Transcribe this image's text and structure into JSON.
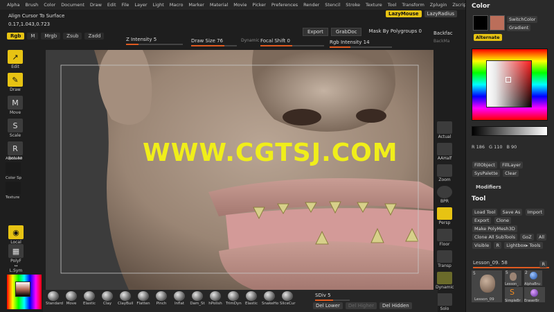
{
  "menu": [
    "Alpha",
    "Brush",
    "Color",
    "Document",
    "Draw",
    "Edit",
    "File",
    "Layer",
    "Light",
    "Macro",
    "Marker",
    "Material",
    "Movie",
    "Picker",
    "Preferences",
    "Render",
    "Stencil",
    "Stroke",
    "Texture",
    "Tool",
    "Transform",
    "Zplugin",
    "Zscript"
  ],
  "lazy": {
    "mouse": "LazyMouse",
    "radius": "LazyRadius"
  },
  "info": {
    "line1": "Align Cursor To Surface",
    "line2": "0.17,1.043,0.723"
  },
  "modes": {
    "rgb": "Rgb",
    "m": "M",
    "mrgb": "Mrgb",
    "zsub": "Zsub",
    "zadd": "Zadd"
  },
  "sliders": {
    "z_intensity": "Z Intensity 5",
    "draw_size": "Draw Size 76",
    "dynamic": "Dynamic",
    "focal_shift": "Focal Shift 0",
    "rgb_intensity": "Rgb Intensity 14",
    "sdiv": "SDiv 5"
  },
  "top_buttons": {
    "export": "Export",
    "grabdoc": "GrabDoc",
    "mask": "Mask By Polygroups 0",
    "backface": "Backfac",
    "backmask": "BackMa"
  },
  "left_tools": [
    {
      "label": "Edit",
      "icon": "↗"
    },
    {
      "label": "Draw",
      "icon": "✎"
    },
    {
      "label": "Move",
      "icon": "M"
    },
    {
      "label": "Scale",
      "icon": "S"
    },
    {
      "label": "Rotate",
      "icon": "R"
    }
  ],
  "left_lower": {
    "alpha": "Alpha 40",
    "color": "Color Sp",
    "texture": "Texture",
    "local": "Local",
    "polyf": "PolyF",
    "lsym": "L.Sym"
  },
  "watermark": "WWW.CGTSJ.COM",
  "right_tools": [
    "Actual",
    "AAHalf",
    "Zoom",
    "BPR",
    "Persp",
    "Floor",
    "Transp",
    "Dynamic",
    "Solo"
  ],
  "brushes": [
    "Standard",
    "Move",
    "Elastic",
    "Clay",
    "ClayBuil",
    "Flatten",
    "Pinch",
    "Inflat",
    "Dam_St",
    "hPolish",
    "TrimDyn",
    "Elastic",
    "SnakeHo",
    "SliceCur"
  ],
  "bottom_buttons": {
    "del_lower": "Del Lower",
    "del_higher": "Del Higher",
    "del_hidden": "Del Hidden"
  },
  "palette": {
    "color_title": "Color",
    "switch_color": "SwitchColor",
    "gradient": "Gradient",
    "alternate": "Alternate",
    "r": "R 186",
    "g": "G 110",
    "b": "B 90",
    "fill_object": "FillObject",
    "fill_layer": "FillLayer",
    "sys_palette": "SysPalette",
    "clear": "Clear",
    "modifiers": "Modifiers",
    "tool_title": "Tool",
    "load_tool": "Load Tool",
    "save_as": "Save As",
    "import": "Import",
    "export": "Export",
    "clone": "Clone",
    "make_polymesh": "Make PolyMesh3D",
    "clone_all": "Clone All SubTools",
    "goz": "GoZ",
    "all": "All",
    "visible": "Visible",
    "r_btn": "R",
    "lightbox_tools": "Lightbox▸ Tools",
    "current_tool": "Lesson_09. 58",
    "tool_r": "R",
    "thumbs": [
      "Lesson_09",
      "Lesson_",
      "AlphaBru",
      "SimpleBr",
      "EraserBr"
    ],
    "counts": [
      "5",
      "5",
      "2"
    ],
    "main_color": "#bb6e5a",
    "secondary_color": "#000000",
    "accent": "#e7c313"
  }
}
